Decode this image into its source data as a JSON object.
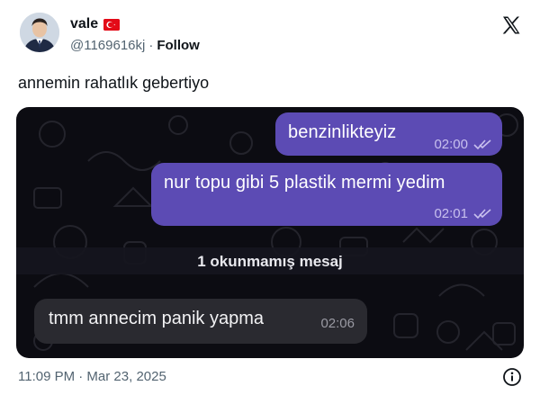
{
  "user": {
    "display_name": "vale",
    "flag_icon": "turkey-flag-icon",
    "handle": "@1169616kj",
    "separator": "·",
    "follow_label": "Follow"
  },
  "tweet": {
    "text": "annemin rahatlık gebertiyo",
    "timestamp": "11:09 PM · Mar 23, 2025"
  },
  "chat": {
    "messages_out": [
      {
        "text": "benzinlikteyiz",
        "time": "02:00",
        "status_icon": "double-check-icon"
      },
      {
        "text": "nur topu gibi 5 plastik mermi yedim",
        "time": "02:01",
        "status_icon": "double-check-icon"
      }
    ],
    "unread_divider": "1 okunmamış mesaj",
    "message_in": {
      "text": "tmm annecim panik yapma",
      "time": "02:06"
    }
  },
  "colors": {
    "outgoing_bubble": "#5c4bb4",
    "incoming_bubble": "#2a2a30",
    "chat_background": "#0c0c12",
    "secondary_text": "#536471"
  }
}
